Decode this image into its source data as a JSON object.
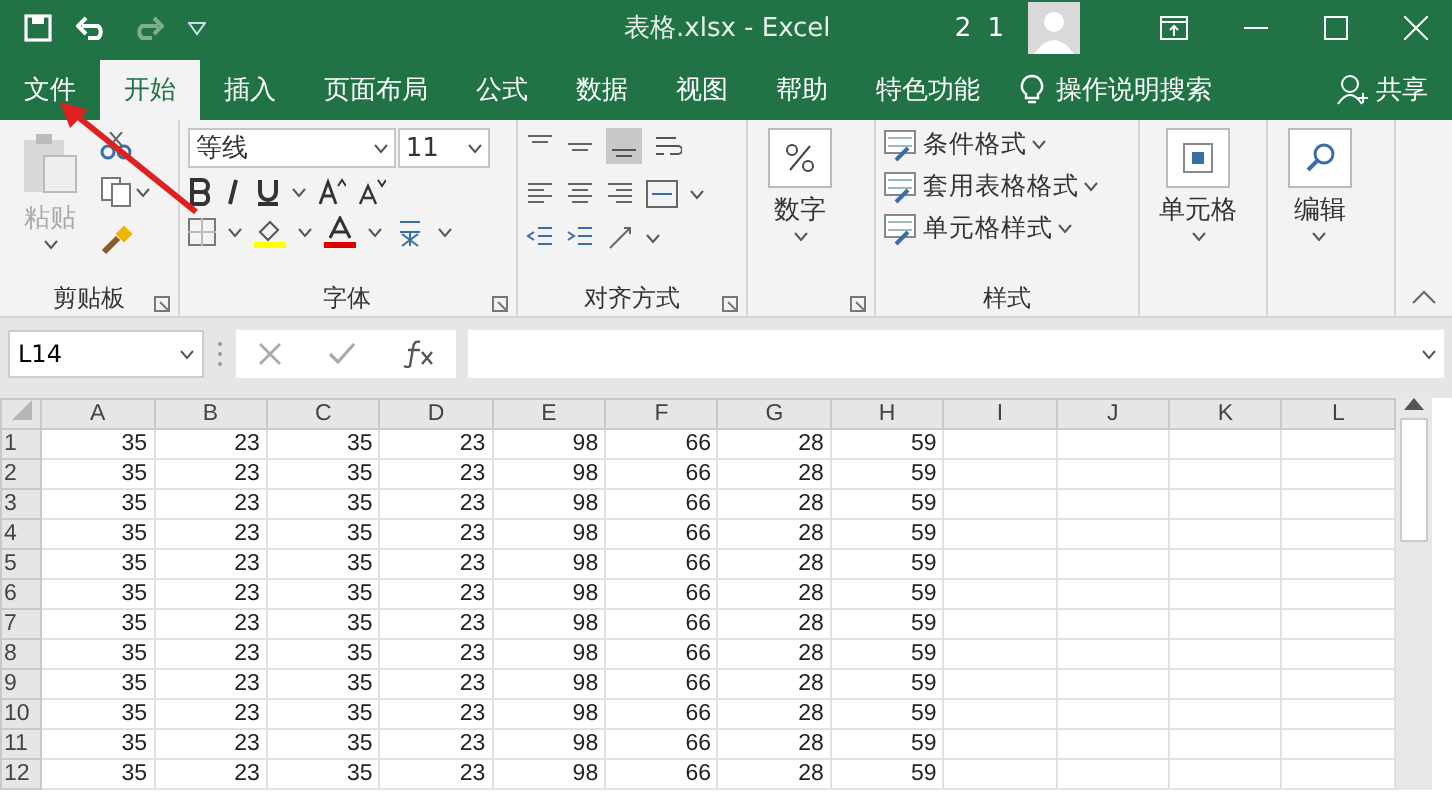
{
  "window": {
    "title": "表格.xlsx  -  Excel",
    "user": "2 1"
  },
  "tabs": [
    {
      "label": "文件",
      "selected": false
    },
    {
      "label": "开始",
      "selected": true
    },
    {
      "label": "插入",
      "selected": false
    },
    {
      "label": "页面布局",
      "selected": false
    },
    {
      "label": "公式",
      "selected": false
    },
    {
      "label": "数据",
      "selected": false
    },
    {
      "label": "视图",
      "selected": false
    },
    {
      "label": "帮助",
      "selected": false
    },
    {
      "label": "特色功能",
      "selected": false
    }
  ],
  "tell_me": {
    "placeholder": "操作说明搜索"
  },
  "share": {
    "label": "共享"
  },
  "ribbon": {
    "clipboard": {
      "paste": "粘贴",
      "label": "剪贴板"
    },
    "font": {
      "name": "等线",
      "size": "11",
      "label": "字体"
    },
    "alignment": {
      "label": "对齐方式"
    },
    "number": {
      "label": "数字"
    },
    "styles": {
      "items": [
        "条件格式",
        "套用表格格式",
        "单元格样式"
      ],
      "label": "样式"
    },
    "cells": {
      "label": "单元格"
    },
    "editing": {
      "label": "编辑"
    }
  },
  "name_box": {
    "value": "L14"
  },
  "columns": [
    "A",
    "B",
    "C",
    "D",
    "E",
    "F",
    "G",
    "H",
    "I",
    "J",
    "K",
    "L"
  ],
  "rows": [
    {
      "number": "1",
      "cells": [
        "35",
        "23",
        "35",
        "23",
        "98",
        "66",
        "28",
        "59"
      ]
    },
    {
      "number": "2",
      "cells": [
        "35",
        "23",
        "35",
        "23",
        "98",
        "66",
        "28",
        "59"
      ]
    },
    {
      "number": "3",
      "cells": [
        "35",
        "23",
        "35",
        "23",
        "98",
        "66",
        "28",
        "59"
      ]
    },
    {
      "number": "4",
      "cells": [
        "35",
        "23",
        "35",
        "23",
        "98",
        "66",
        "28",
        "59"
      ]
    },
    {
      "number": "5",
      "cells": [
        "35",
        "23",
        "35",
        "23",
        "98",
        "66",
        "28",
        "59"
      ]
    },
    {
      "number": "6",
      "cells": [
        "35",
        "23",
        "35",
        "23",
        "98",
        "66",
        "28",
        "59"
      ]
    },
    {
      "number": "7",
      "cells": [
        "35",
        "23",
        "35",
        "23",
        "98",
        "66",
        "28",
        "59"
      ]
    },
    {
      "number": "8",
      "cells": [
        "35",
        "23",
        "35",
        "23",
        "98",
        "66",
        "28",
        "59"
      ]
    },
    {
      "number": "9",
      "cells": [
        "35",
        "23",
        "35",
        "23",
        "98",
        "66",
        "28",
        "59"
      ]
    },
    {
      "number": "10",
      "cells": [
        "35",
        "23",
        "35",
        "23",
        "98",
        "66",
        "28",
        "59"
      ]
    },
    {
      "number": "11",
      "cells": [
        "35",
        "23",
        "35",
        "23",
        "98",
        "66",
        "28",
        "59"
      ]
    },
    {
      "number": "12",
      "cells": [
        "35",
        "23",
        "35",
        "23",
        "98",
        "66",
        "28",
        "59"
      ]
    }
  ]
}
